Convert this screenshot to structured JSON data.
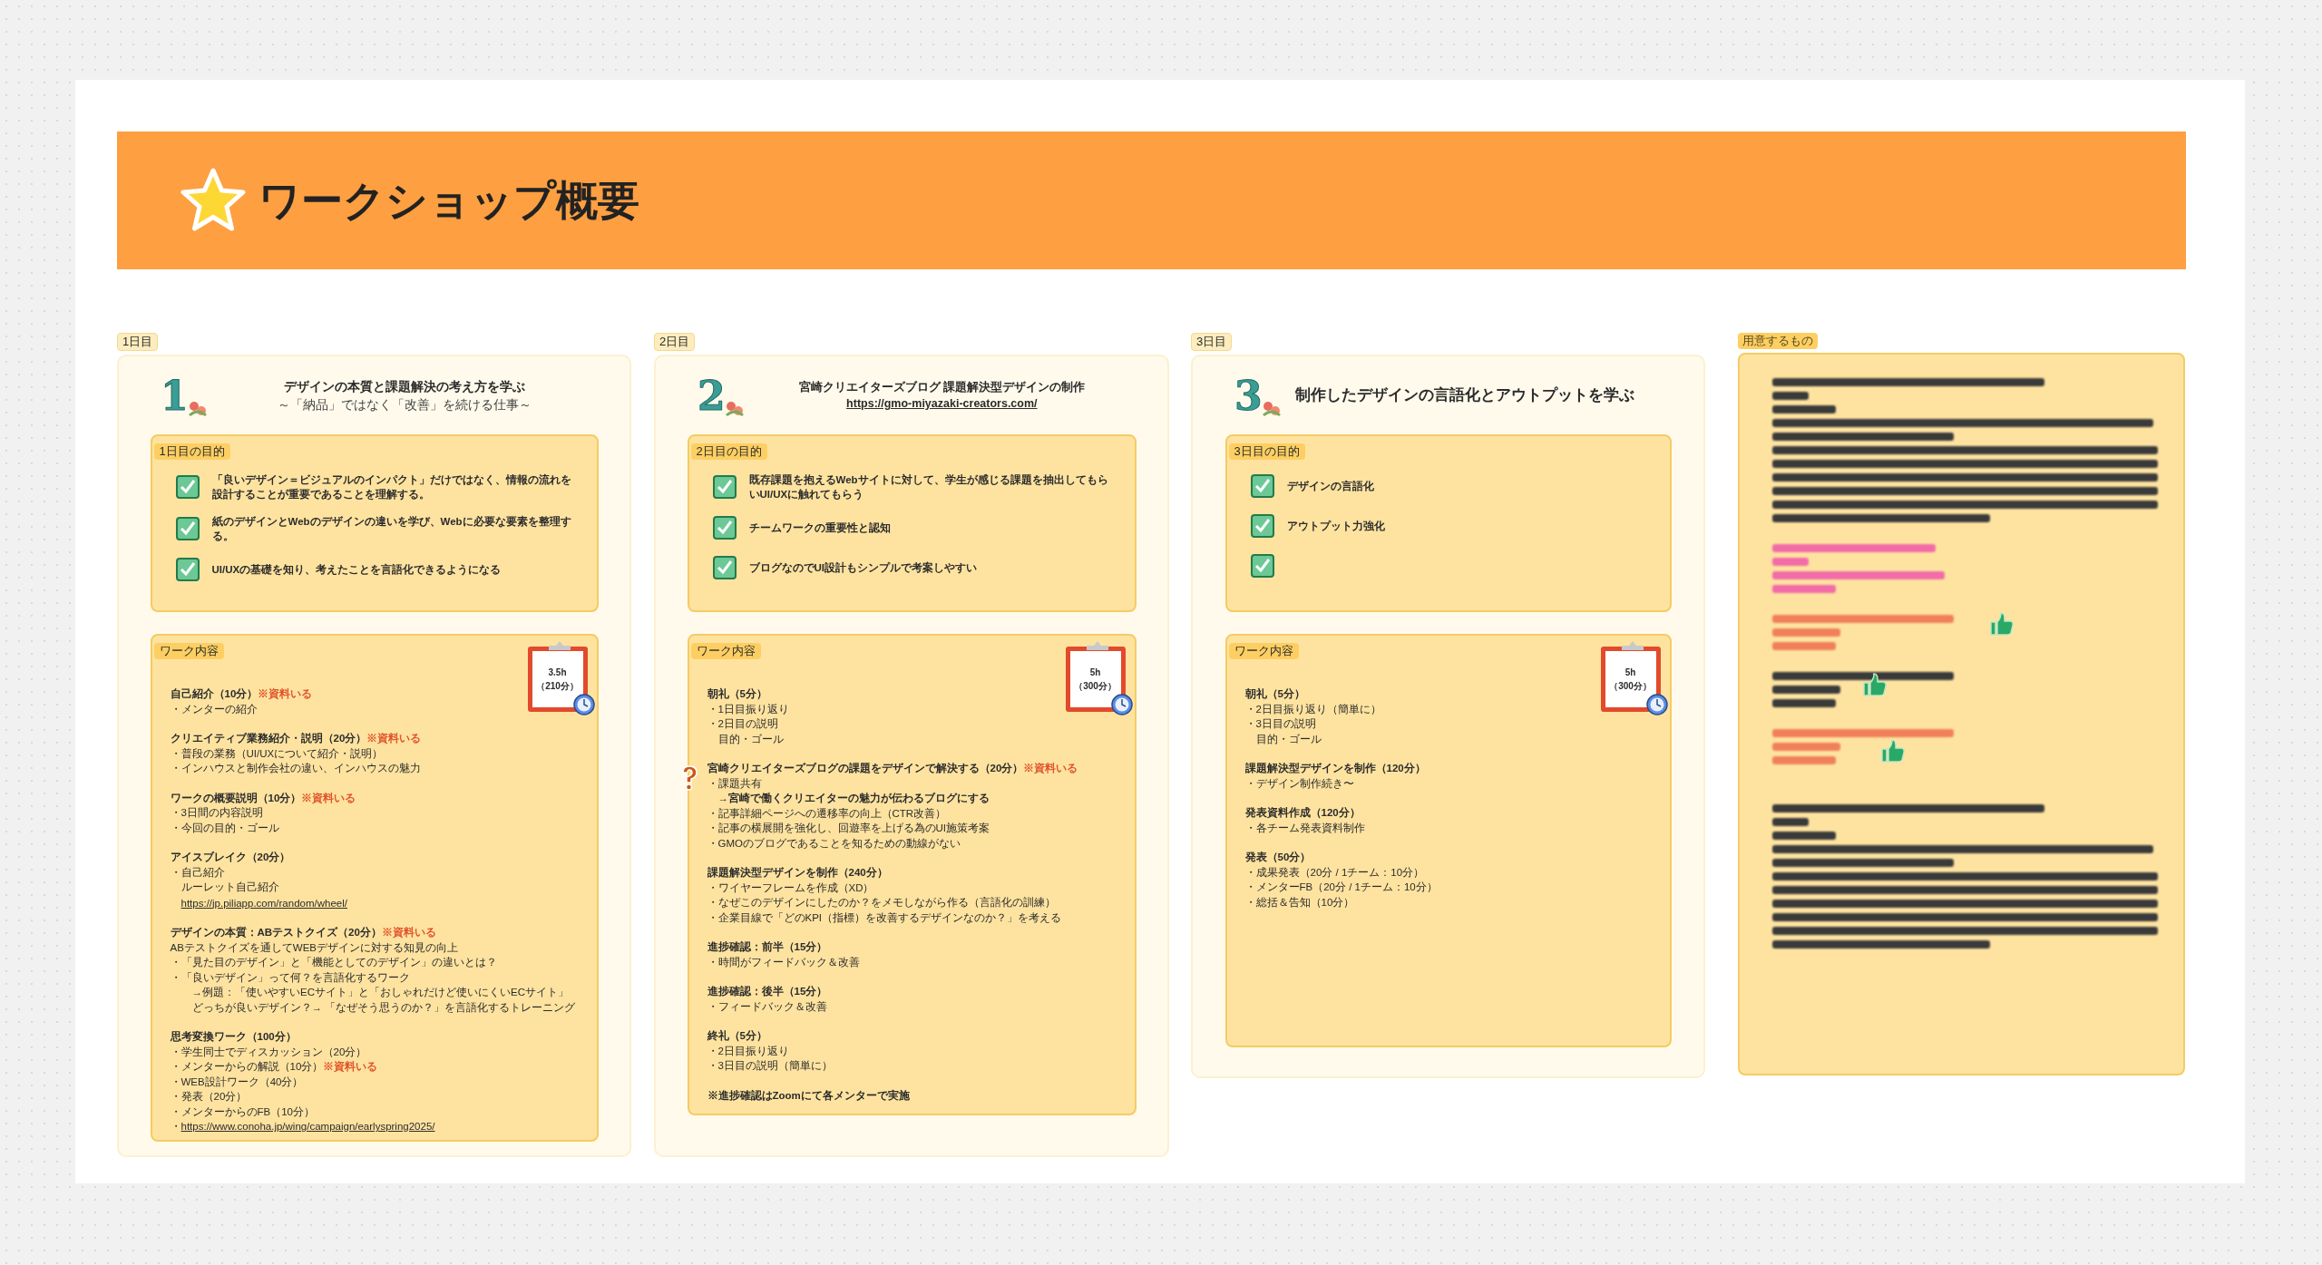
{
  "header": {
    "title": "ワークショップ概要"
  },
  "days": [
    {
      "label": "1日目",
      "numeral": "1",
      "title": "デザインの本質と課題解決の考え方を学ぶ",
      "subtitle": "～「納品」ではなく「改善」を続ける仕事～",
      "purpose": {
        "label": "1日目の目的",
        "items": [
          {
            "text": "「良いデザイン＝ビジュアルのインパクト」だけではなく、情報の流れを設計することが重要であることを理解する。",
            "checked": true
          },
          {
            "text": "紙のデザインとWebのデザインの違いを学び、Webに必要な要素を整理する。",
            "checked": true
          },
          {
            "text": "UI/UXの基礎を知り、考えたことを言語化できるようになる",
            "checked": true
          }
        ]
      },
      "work": {
        "label": "ワーク内容",
        "duration": [
          "3.5h",
          "（210分）"
        ],
        "blocks": [
          {
            "heading": "自己紹介（10分）",
            "note": "※資料いる",
            "lines": [
              {
                "kind": "text",
                "text": "・メンターの紹介"
              }
            ]
          },
          {
            "heading": "クリエイティブ業務紹介・説明（20分）",
            "note": "※資料いる",
            "lines": [
              {
                "kind": "text",
                "text": "・普段の業務（UI/UXについて紹介・説明）"
              },
              {
                "kind": "text",
                "text": "・インハウスと制作会社の違い、インハウスの魅力"
              }
            ]
          },
          {
            "heading": "ワークの概要説明（10分）",
            "note": "※資料いる",
            "lines": [
              {
                "kind": "text",
                "text": "・3日間の内容説明"
              },
              {
                "kind": "text",
                "text": "・今回の目的・ゴール"
              }
            ]
          },
          {
            "heading": "アイスブレイク（20分）",
            "lines": [
              {
                "kind": "text",
                "text": "・自己紹介"
              },
              {
                "kind": "indent",
                "text": "ルーレット自己紹介"
              },
              {
                "kind": "link_indent",
                "text": "https://jp.piliapp.com/random/wheel/"
              }
            ]
          },
          {
            "heading": "デザインの本質：ABテストクイズ（20分）",
            "note": "※資料いる",
            "lines": [
              {
                "kind": "text",
                "text": "ABテストクイズを通してWEBデザインに対する知見の向上"
              },
              {
                "kind": "text",
                "text": "・「見た目のデザイン」と「機能としてのデザイン」の違いとは？"
              },
              {
                "kind": "text",
                "text": "・「良いデザイン」って何？を言語化するワーク"
              },
              {
                "kind": "indent2",
                "text": "→例題：「使いやすいECサイト」と「おしゃれだけど使いにくいECサイト」"
              },
              {
                "kind": "indent2",
                "text": "どっちが良いデザイン？→ 「なぜそう思うのか？」を言語化するトレーニング"
              }
            ]
          },
          {
            "heading": "思考変換ワーク（100分）",
            "lines": [
              {
                "kind": "text",
                "text": "・学生同士でディスカッション（20分）"
              },
              {
                "kind": "text",
                "text": "・メンターからの解説（10分）",
                "note": "※資料いる"
              },
              {
                "kind": "text",
                "text": "・WEB設計ワーク（40分）"
              },
              {
                "kind": "text",
                "text": "・発表（20分）"
              },
              {
                "kind": "text",
                "text": "・メンターからのFB（10分）"
              },
              {
                "kind": "link_bullet",
                "bullet": "・",
                "text": "https://www.conoha.jp/wing/campaign/earlyspring2025/"
              }
            ]
          }
        ]
      }
    },
    {
      "label": "2日目",
      "numeral": "2",
      "title": "宮崎クリエイターズブログ 課題解決型デザインの制作",
      "link": "https://gmo-miyazaki-creators.com/",
      "purpose": {
        "label": "2日目の目的",
        "items": [
          {
            "text": "既存課題を抱えるWebサイトに対して、学生が感じる課題を抽出してもらいUI/UXに触れてもらう",
            "checked": true
          },
          {
            "text": "チームワークの重要性と認知",
            "checked": true
          },
          {
            "text": "ブログなのでUI設計もシンプルで考案しやすい",
            "checked": true
          }
        ]
      },
      "work": {
        "label": "ワーク内容",
        "duration": [
          "5h",
          "（300分）"
        ],
        "blocks": [
          {
            "heading": "朝礼（5分）",
            "lines": [
              {
                "kind": "text",
                "text": "・1日目振り返り"
              },
              {
                "kind": "text",
                "text": "・2日目の説明"
              },
              {
                "kind": "indent",
                "text": "目的・ゴール"
              }
            ]
          },
          {
            "heading": "宮崎クリエイターズブログの課題をデザインで解決する（20分）",
            "note": "※資料いる",
            "kind": "question",
            "lines": [
              {
                "kind": "text",
                "text": "・課題共有"
              },
              {
                "kind": "strong_indent",
                "text": "→宮崎で働くクリエイターの魅力が伝わるブログにする"
              },
              {
                "kind": "text",
                "text": "・記事詳細ページへの遷移率の向上（CTR改善）"
              },
              {
                "kind": "text",
                "text": "・記事の横展開を強化し、回遊率を上げる為のUI施策考案"
              },
              {
                "kind": "text",
                "text": "・GMOのブログであることを知るための動線がない"
              }
            ]
          },
          {
            "heading": "課題解決型デザインを制作（240分）",
            "lines": [
              {
                "kind": "text",
                "text": "・ワイヤーフレームを作成（XD）"
              },
              {
                "kind": "text",
                "text": "・なぜこのデザインにしたのか？をメモしながら作る（言語化の訓練）"
              },
              {
                "kind": "text",
                "text": "・企業目線で「どのKPI（指標）を改善するデザインなのか？」を考える"
              }
            ]
          },
          {
            "heading": "進捗確認：前半（15分）",
            "lines": [
              {
                "kind": "text",
                "text": "・時間がフィードバック＆改善"
              }
            ]
          },
          {
            "heading": "進捗確認：後半（15分）",
            "lines": [
              {
                "kind": "text",
                "text": "・フィードバック＆改善"
              }
            ]
          },
          {
            "heading": "終礼（5分）",
            "lines": [
              {
                "kind": "text",
                "text": "・2日目振り返り"
              },
              {
                "kind": "text",
                "text": "・3日目の説明（簡単に）"
              }
            ]
          },
          {
            "heading": "※進捗確認はZoomにて各メンターで実施"
          }
        ]
      }
    },
    {
      "label": "3日目",
      "numeral": "3",
      "title": "制作したデザインの言語化とアウトプットを学ぶ",
      "purpose": {
        "label": "3日目の目的",
        "items": [
          {
            "text": "デザインの言語化",
            "checked": true
          },
          {
            "text": "アウトプット力強化",
            "checked": true
          },
          {
            "checked": true
          }
        ]
      },
      "work": {
        "label": "ワーク内容",
        "duration": [
          "5h",
          "（300分）"
        ],
        "blocks": [
          {
            "heading": "朝礼（5分）",
            "lines": [
              {
                "kind": "text",
                "text": "・2日目振り返り（簡単に）"
              },
              {
                "kind": "text",
                "text": "・3日目の説明"
              },
              {
                "kind": "indent",
                "text": "目的・ゴール"
              }
            ]
          },
          {
            "heading": "課題解決型デザインを制作（120分）",
            "lines": [
              {
                "kind": "text",
                "text": "・デザイン制作続き〜"
              }
            ]
          },
          {
            "heading": "発表資料作成（120分）",
            "lines": [
              {
                "kind": "text",
                "text": "・各チーム発表資料制作"
              }
            ]
          },
          {
            "heading": "発表（50分）",
            "lines": [
              {
                "kind": "text",
                "text": "・成果発表（20分 / 1チーム：10分）"
              },
              {
                "kind": "text",
                "text": "・メンターFB（20分 / 1チーム：10分）"
              },
              {
                "kind": "text",
                "text": "・総括＆告知（10分）"
              }
            ]
          }
        ]
      }
    }
  ],
  "supplies": {
    "label": "用意するもの",
    "items": [
      {
        "kind": "long",
        "color": "#3a3a3a",
        "liked": false
      },
      {
        "kind": "medium",
        "color": "#f26ca7",
        "liked": false
      },
      {
        "kind": "short",
        "color": "#f0805a",
        "liked": true
      },
      {
        "kind": "short",
        "color": "#3a3a3a",
        "liked": true
      },
      {
        "kind": "short",
        "color": "#f0805a",
        "liked": true
      },
      {
        "kind": "long",
        "color": "#3a3a3a",
        "liked": false
      }
    ]
  }
}
